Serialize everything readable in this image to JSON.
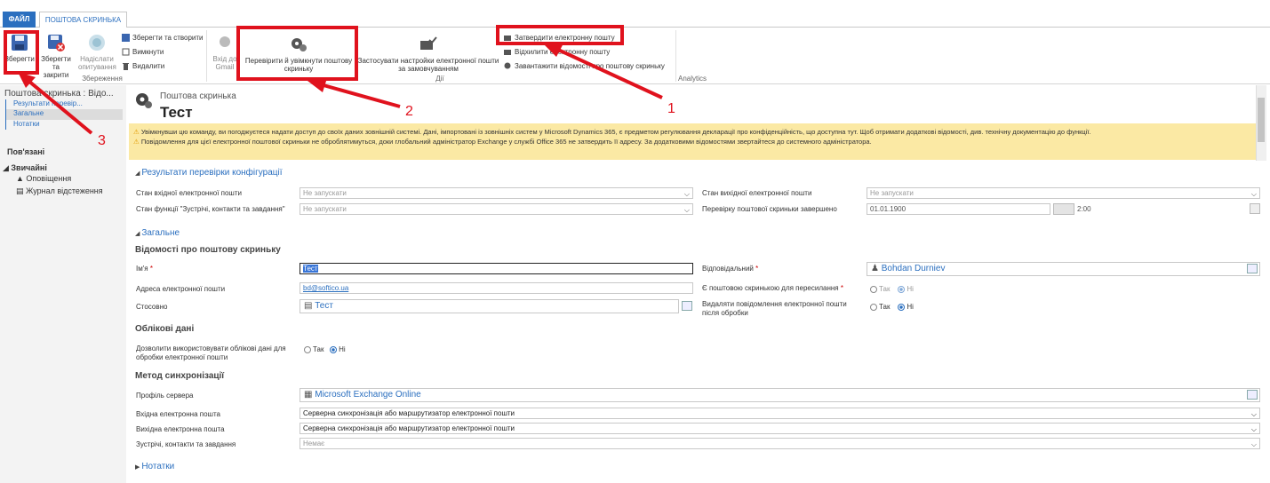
{
  "tabs": {
    "file": "ФАЙЛ",
    "mailbox": "ПОШТОВА СКРИНЬКА"
  },
  "ribbon": {
    "save": "Зберегти",
    "save_close": "Зберегти та закрити",
    "send_survey": "Надіслати опитування",
    "save_new": "Зберегти та створити",
    "deactivate": "Вимкнути",
    "delete": "Видалити",
    "group_save": "Збереження",
    "gmail": "Вхід до Gmail",
    "test_enable": "Перевірити й увімкнути поштову скриньку",
    "apply_default": "Застосувати настройки електронної пошти за замовчуванням",
    "group_actions": "Дії",
    "approve_email": "Затвердити електронну пошту",
    "reject_email": "Відхилити електронну пошту",
    "download_alerts": "Завантажити відомості про поштову скриньку",
    "group_analytics": "Analytics"
  },
  "leftnav": {
    "title": "Поштова скринька : Відо...",
    "links": [
      "Результати перевір...",
      "Загальне",
      "Нотатки"
    ],
    "related": "Пов'язані",
    "common": "Звичайні",
    "items": [
      "Оповіщення",
      "Журнал відстеження"
    ]
  },
  "header": {
    "entity": "Поштова скринька",
    "name": "Тест"
  },
  "alert": {
    "line1": "Увімкнувши цю команду, ви погоджуєтеся надати доступ до своїх даних зовнішній системі. Дані, імпортовані із зовнішніх систем у Microsoft Dynamics 365, є предметом регулювання декларації про конфіденційність, що доступна тут. Щоб отримати додаткові відомості, див. технічну документацію до функції.",
    "line2": "Повідомлення для цієї електронної поштової скриньки не оброблятимуться, доки глобальний адміністратор Exchange у службі Office 365 не затвердить її адресу. За додатковими відомостями звертайтеся до системного адміністратора."
  },
  "config_section": {
    "title": "Результати перевірки конфігурації",
    "incoming_label": "Стан вхідної електронної пошти",
    "incoming_value": "Не запускати",
    "appointments_label": "Стан функції \"Зустрічі, контакти та завдання\"",
    "appointments_value": "Не запускати",
    "outgoing_label": "Стан вихідної електронної пошти",
    "outgoing_value": "Не запускати",
    "test_completed_label": "Перевірку поштової скриньки завершено",
    "test_completed_date": "01.01.1900",
    "test_completed_time": "2:00"
  },
  "general_section": {
    "title": "Загальне",
    "info_head": "Відомості про поштову скриньку",
    "name_label": "Ім'я",
    "name_value": "Тест",
    "email_label": "Адреса електронної пошти",
    "email_value": "bd@softico.ua",
    "regarding_label": "Стосовно",
    "regarding_value": "Тест",
    "owner_label": "Відповідальний",
    "owner_value": "Bohdan Durniev",
    "forward_label": "Є поштовою скринькою для пересилання",
    "delete_label": "Видаляти повідомлення електронної пошти після обробки",
    "yes": "Так",
    "no": "Ні",
    "cred_head": "Облікові дані",
    "cred_label": "Дозволити використовувати облікові дані для обробки електронної пошти",
    "sync_head": "Метод синхронізації",
    "profile_label": "Профіль сервера",
    "profile_value": "Microsoft Exchange Online",
    "in_label": "Вхідна електронна пошта",
    "in_value": "Серверна синхронізація або маршрутизатор електронної пошти",
    "out_label": "Вихідна електронна пошта",
    "out_value": "Серверна синхронізація або маршрутизатор електронної пошти",
    "act_label": "Зустрічі, контакти та завдання",
    "act_value": "Немає"
  },
  "notes_section": {
    "title": "Нотатки"
  },
  "annotations": {
    "n1": "1",
    "n2": "2",
    "n3": "3"
  },
  "colors": {
    "accent": "#2b6fbf",
    "annotation": "#e0121d",
    "alert_bg": "#fbe9a4"
  }
}
